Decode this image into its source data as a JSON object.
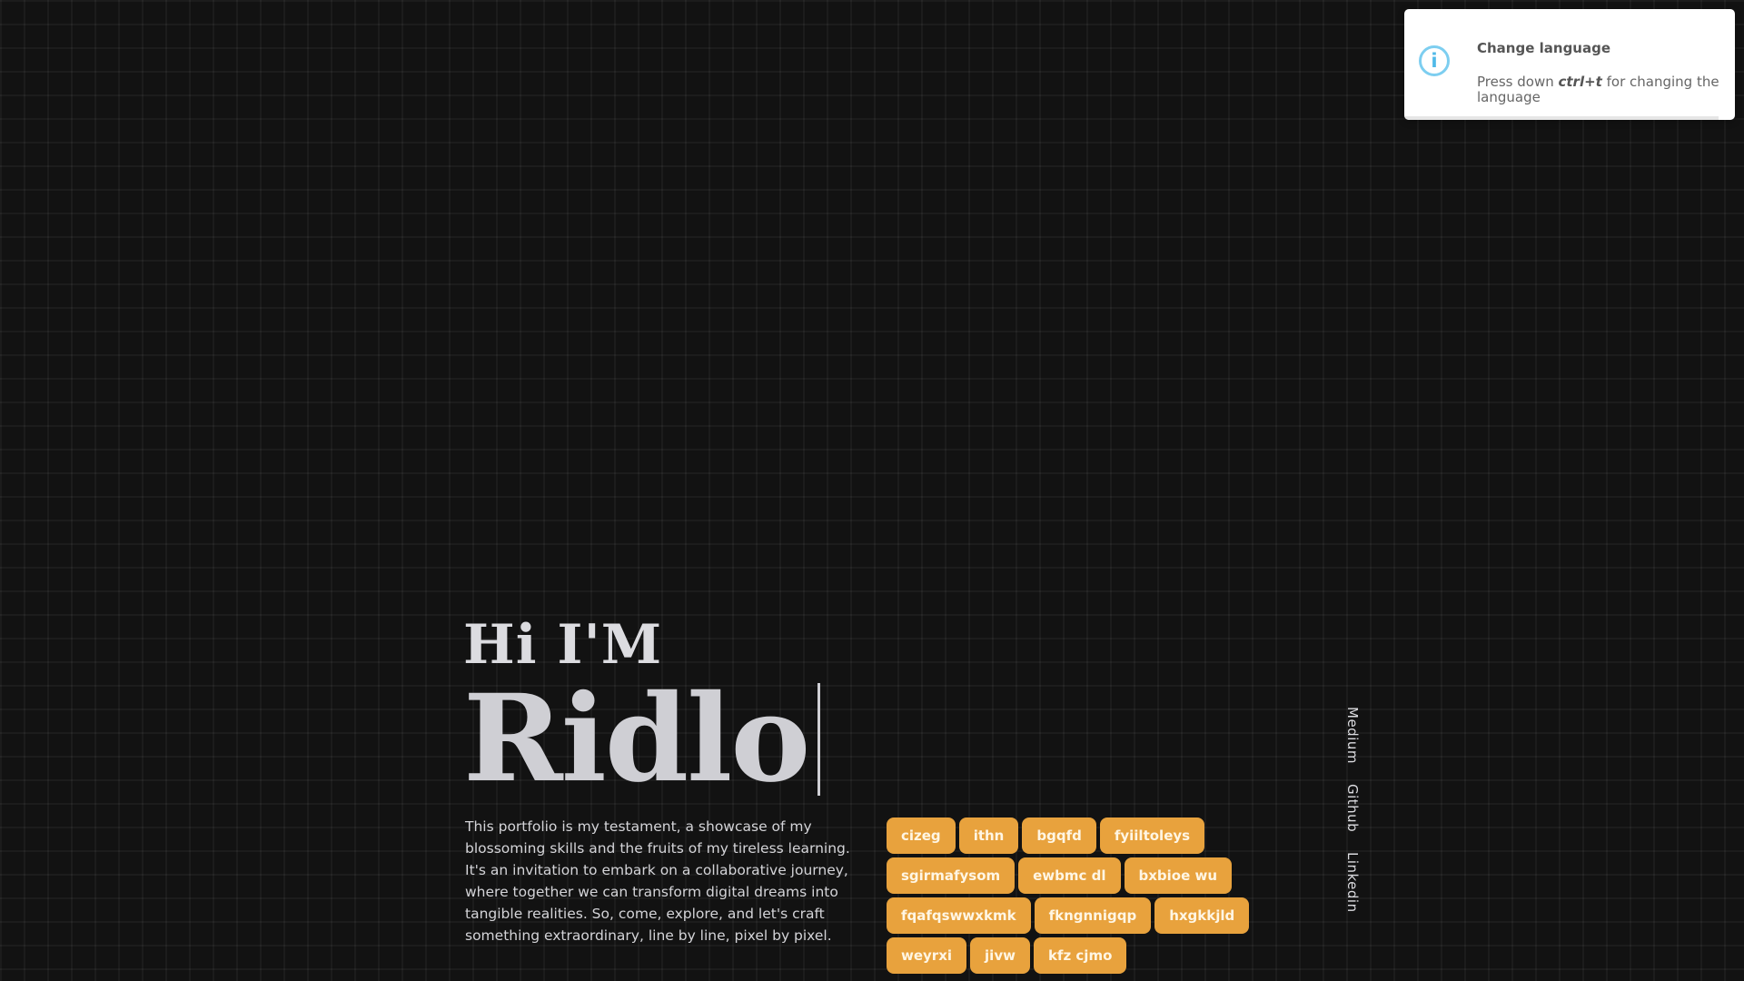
{
  "toast": {
    "icon": "info-icon",
    "title": "Change language",
    "message_prefix": "Press down ",
    "shortcut": "ctrl+t",
    "message_suffix": " for changing the language"
  },
  "hero": {
    "greeting": "Hi I'M",
    "name": "Ridlo",
    "bio": "This portfolio is my testament, a showcase of my blossoming skills and the fruits of my tireless learning. It's an invitation to embark on a collaborative journey, where together we can transform digital dreams into tangible realities. So, come, explore, and let's craft something extraordinary, line by line, pixel by pixel."
  },
  "tags": [
    [
      "cizeg",
      "ithn",
      "bgqfd",
      "fyiiltoleys"
    ],
    [
      "sgirmafysom",
      "ewbmc dl",
      "bxbioe wu"
    ],
    [
      "fqafqswwxkmk",
      "fkngnnigqp",
      "hxgkkjld"
    ],
    [
      "weyrxi",
      "jivw",
      "kfz cjmo"
    ]
  ],
  "social": {
    "links": [
      "Medium",
      "Github",
      "Linkedin"
    ]
  },
  "colors": {
    "background": "#121212",
    "tag": "#e8a23d",
    "info_icon": "#4fb9e8"
  }
}
